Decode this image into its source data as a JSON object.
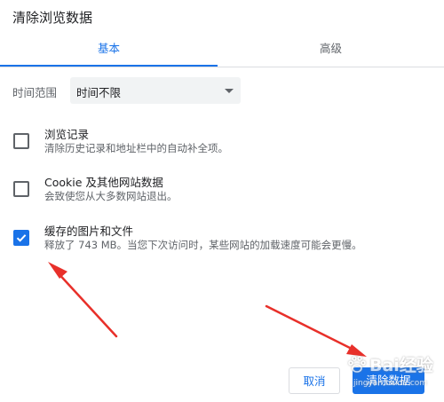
{
  "dialog": {
    "title": "清除浏览数据",
    "tabs": [
      {
        "label": "基本",
        "active": true
      },
      {
        "label": "高级",
        "active": false
      }
    ],
    "time_range": {
      "label": "时间范围",
      "selected": "时间不限"
    },
    "items": [
      {
        "title": "浏览记录",
        "subtitle": "清除历史记录和地址栏中的自动补全项。",
        "checked": false
      },
      {
        "title": "Cookie 及其他网站数据",
        "subtitle": "会致使您从大多数网站退出。",
        "checked": false
      },
      {
        "title": "缓存的图片和文件",
        "subtitle": "释放了 743 MB。当您下次访问时，某些网站的加载速度可能会更慢。",
        "checked": true
      }
    ],
    "buttons": {
      "cancel": "取消",
      "clear": "清除数据"
    }
  },
  "watermark": {
    "brand": "Bai经验",
    "url": "jingyan.baidu.com"
  },
  "colors": {
    "accent": "#1a73e8",
    "annotation_arrow": "#e8302a",
    "text_primary": "#202124",
    "text_secondary": "#5f6368"
  }
}
